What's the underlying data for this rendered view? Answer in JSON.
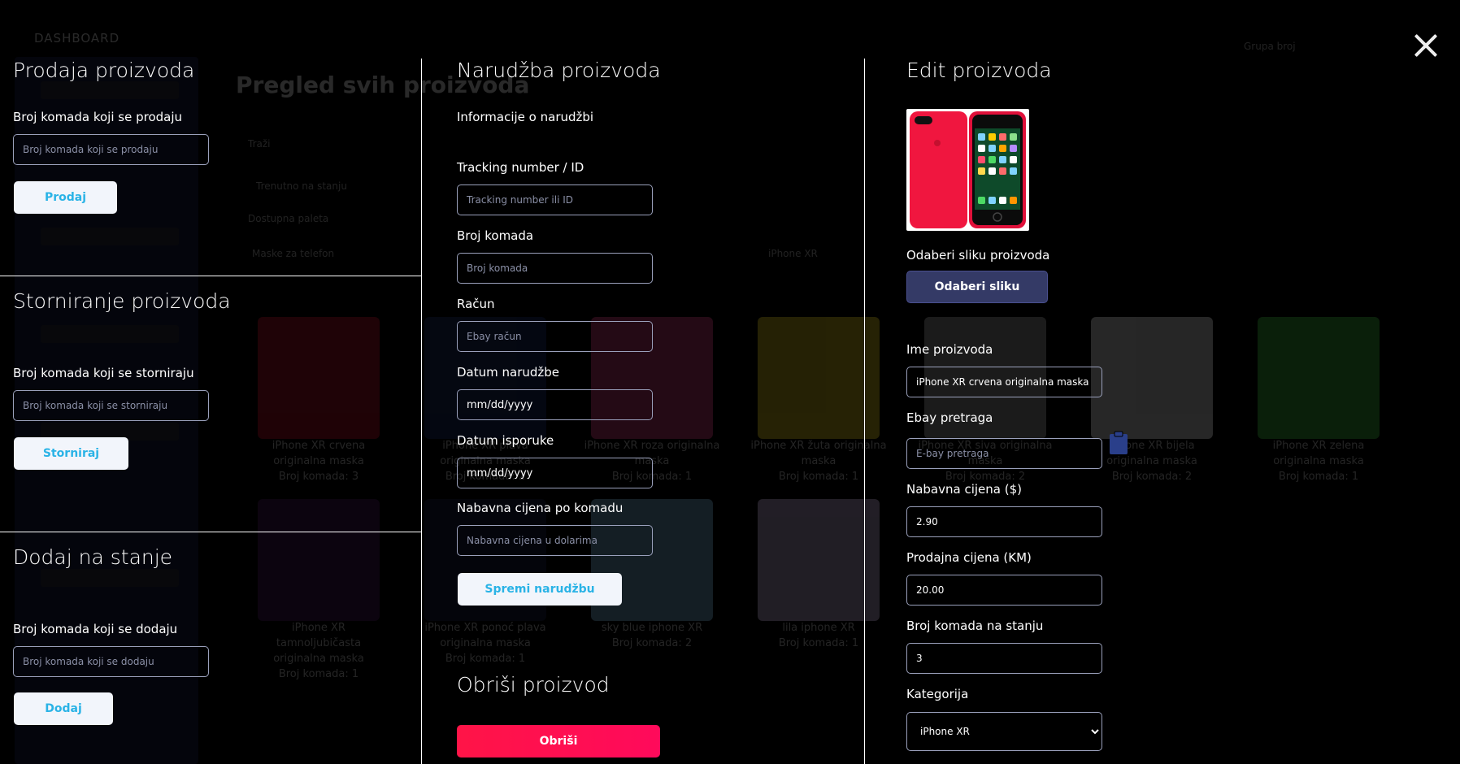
{
  "background": {
    "brand": "DASHBOARD",
    "page_title": "Pregled svih proizvoda",
    "profile_select": "Grupa broj",
    "filters": [
      "Traži",
      "Trenutno na stanju",
      "Dostupna paleta",
      "Maske za telefon"
    ],
    "filter_value": "iPhone XR",
    "cards": [
      {
        "name": "iPhone XR crvena originalna maska",
        "qty": "Broj komada: 3"
      },
      {
        "name": "iPhone XR plava originalna maska",
        "qty": "Broj komada: 2"
      },
      {
        "name": "iPhone XR roza originalna maska",
        "qty": "Broj komada: 1"
      },
      {
        "name": "iPhone XR žuta originalna maska",
        "qty": "Broj komada: 1"
      },
      {
        "name": "iPhone XR siva originalna maska",
        "qty": "Broj komada: 2"
      },
      {
        "name": "iPhone XR bijela originalna maska",
        "qty": "Broj komada: 2"
      },
      {
        "name": "iPhone XR zelena originalna maska",
        "qty": "Broj komada: 1"
      },
      {
        "name": "iPhone XR tamnoljubičasta originalna maska",
        "qty": "Broj komada: 1"
      },
      {
        "name": "iPhone XR ponoć plava originalna maska",
        "qty": "Broj komada: 1"
      },
      {
        "name": "sky blue iphone XR",
        "qty": "Broj komada: 2"
      },
      {
        "name": "lila iphone XR",
        "qty": "Broj komada: 1"
      }
    ]
  },
  "sale": {
    "title": "Prodaja proizvoda",
    "label": "Broj komada koji se prodaju",
    "placeholder": "Broj komada koji se prodaju",
    "button": "Prodaj"
  },
  "cancel": {
    "title": "Storniranje proizvoda",
    "label": "Broj komada koji se storniraju",
    "placeholder": "Broj komada koji se storniraju",
    "button": "Storniraj"
  },
  "add_stock": {
    "title": "Dodaj na stanje",
    "label": "Broj komada koji se dodaju",
    "placeholder": "Broj komada koji se dodaju",
    "button": "Dodaj"
  },
  "order": {
    "title": "Narudžba proizvoda",
    "subtitle": "Informacije o narudžbi",
    "tracking_label": "Tracking number / ID",
    "tracking_placeholder": "Tracking number ili ID",
    "qty_label": "Broj komada",
    "qty_placeholder": "Broj komada",
    "account_label": "Račun",
    "account_placeholder": "Ebay račun",
    "order_date_label": "Datum narudžbe",
    "order_date_value": "mm/dd/yyyy",
    "delivery_date_label": "Datum isporuke",
    "delivery_date_value": "mm/dd/yyyy",
    "unit_price_label": "Nabavna cijena po komadu",
    "unit_price_placeholder": "Nabavna cijena u dolarima",
    "save_button": "Spremi narudžbu"
  },
  "delete": {
    "title": "Obriši proizvod",
    "button": "Obriši"
  },
  "edit": {
    "title": "Edit proizvoda",
    "image_label": "Odaberi sliku proizvoda",
    "image_button": "Odaberi sliku",
    "name_label": "Ime proizvoda",
    "name_value": "iPhone XR crvena originalna maska",
    "ebay_label": "Ebay pretraga",
    "ebay_placeholder": "E-bay pretraga",
    "buy_price_label": "Nabavna cijena ($)",
    "buy_price_value": "2.90",
    "sell_price_label": "Prodajna cijena (KM)",
    "sell_price_value": "20.00",
    "stock_label": "Broj komada na stanju",
    "stock_value": "3",
    "category_label": "Kategorija",
    "category_value": "iPhone XR"
  },
  "colors": {
    "accent_blue": "#2ab3e6",
    "delete_red": "#ff1447",
    "dark_button": "#343a66"
  }
}
